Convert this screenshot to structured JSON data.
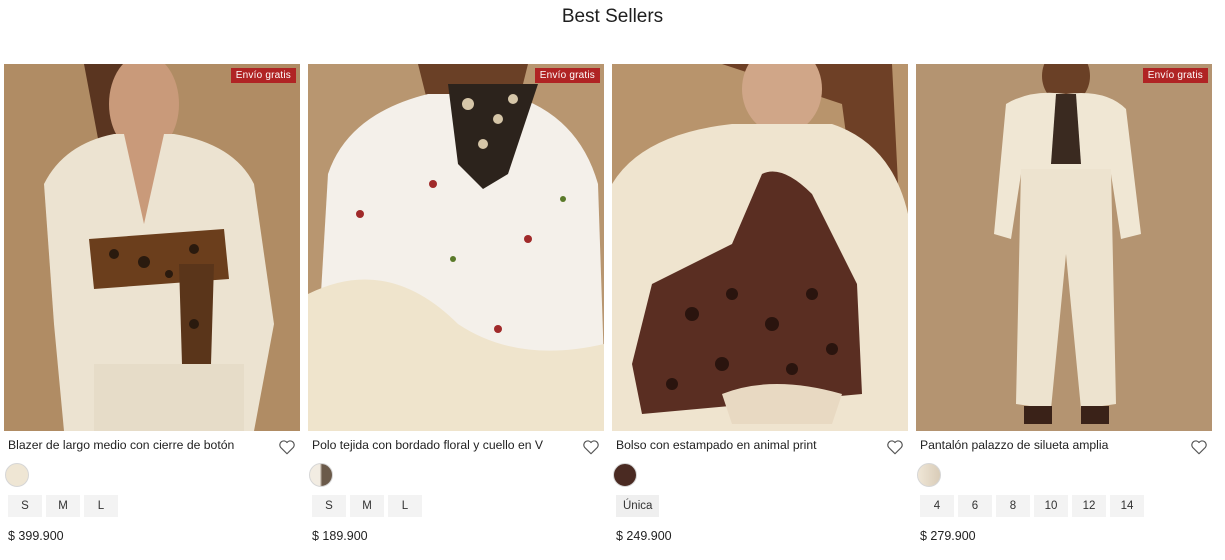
{
  "section": {
    "title": "Best Sellers"
  },
  "products": [
    {
      "badge": "Envío gratis",
      "name": "Blazer de largo medio con cierre de botón",
      "sizes": [
        "S",
        "M",
        "L"
      ],
      "price": "$ 399.900",
      "swatch_color": "#efe6d4"
    },
    {
      "badge": "Envío gratis",
      "name": "Polo tejida con bordado floral y cuello en V",
      "sizes": [
        "S",
        "M",
        "L"
      ],
      "price": "$ 189.900",
      "swatch_color": "#6b5a4a"
    },
    {
      "name": "Bolso con estampado en animal print",
      "sizes": [
        "Única"
      ],
      "price": "$ 249.900",
      "swatch_color": "#4a2a22"
    },
    {
      "badge": "Envío gratis",
      "name": "Pantalón palazzo de silueta amplia",
      "sizes": [
        "4",
        "6",
        "8",
        "10",
        "12",
        "14"
      ],
      "price": "$ 279.900",
      "swatch_color": "#d9ccb8"
    }
  ],
  "colors": {
    "badge": "#b02424",
    "background": "#ffffff"
  },
  "icons": {
    "favorite": "heart-outline-icon"
  }
}
